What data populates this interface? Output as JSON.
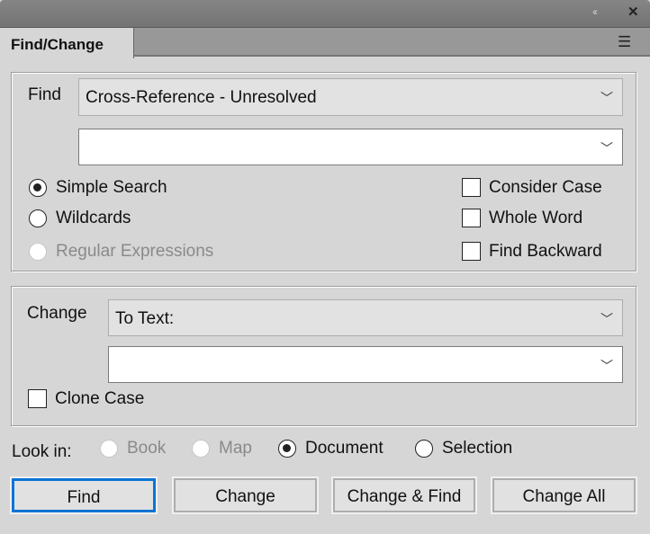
{
  "panel": {
    "tab": "Find/Change",
    "collapse_icon": "double-chevron-left-icon",
    "close_icon": "close-icon",
    "menu_icon": "hamburger-menu-icon"
  },
  "find": {
    "label": "Find",
    "query_type": "Cross-Reference - Unresolved",
    "text_value": "",
    "modes": [
      {
        "label": "Simple Search",
        "selected": true,
        "enabled": true
      },
      {
        "label": "Wildcards",
        "selected": false,
        "enabled": true
      },
      {
        "label": "Regular Expressions",
        "selected": false,
        "enabled": false
      }
    ],
    "options": [
      {
        "label": "Consider Case",
        "checked": false
      },
      {
        "label": "Whole Word",
        "checked": false
      },
      {
        "label": "Find Backward",
        "checked": false
      }
    ]
  },
  "change": {
    "label": "Change",
    "type": "To Text:",
    "text_value": "",
    "clone_case": {
      "label": "Clone Case",
      "checked": false
    }
  },
  "look_in": {
    "label": "Look in:",
    "options": [
      {
        "label": "Book",
        "enabled": false,
        "selected": false
      },
      {
        "label": "Map",
        "enabled": false,
        "selected": false
      },
      {
        "label": "Document",
        "enabled": true,
        "selected": true
      },
      {
        "label": "Selection",
        "enabled": true,
        "selected": false
      }
    ]
  },
  "buttons": {
    "find": "Find",
    "change": "Change",
    "change_find": "Change & Find",
    "change_all": "Change All"
  },
  "colors": {
    "default_button_border": "#0a74d6"
  }
}
